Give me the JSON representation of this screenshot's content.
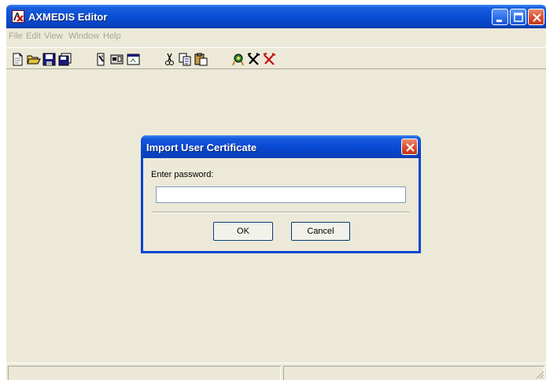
{
  "window": {
    "title": "AXMEDIS Editor",
    "icon": "axmedis-logo-icon"
  },
  "menu": {
    "items": [
      "File",
      "Edit",
      "View",
      "Window",
      "Help"
    ]
  },
  "toolbar": {
    "buttons": [
      "new-document-icon",
      "open-folder-icon",
      "save-disk-icon",
      "save-all-icon",
      "properties-icon",
      "component-icon",
      "window-icon",
      "cut-icon",
      "copy-icon",
      "paste-icon",
      "certificate-icon",
      "tools-icon",
      "tools-red-icon"
    ]
  },
  "dialog": {
    "title": "Import User Certificate",
    "label": "Enter password:",
    "password_value": "",
    "ok_label": "OK",
    "cancel_label": "Cancel"
  },
  "colors": {
    "titlebar": "#0a4fd6",
    "window_bg": "#ece9d8",
    "close_button": "#d9482a"
  }
}
